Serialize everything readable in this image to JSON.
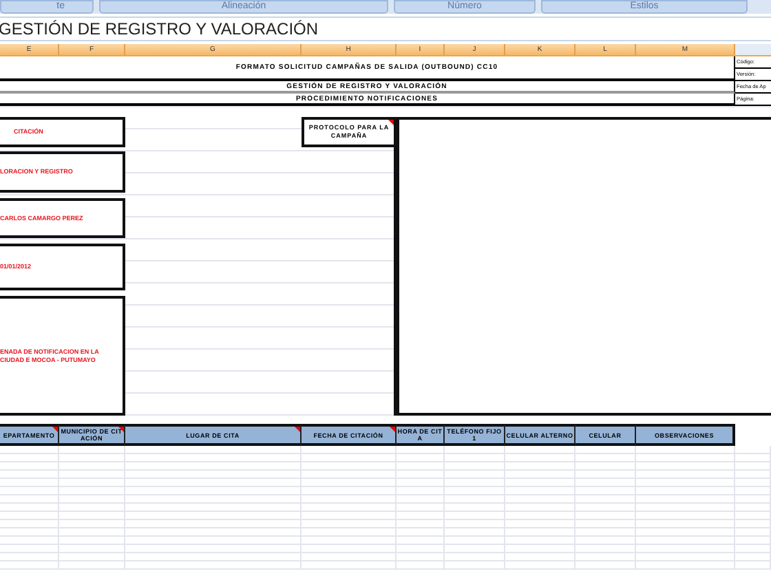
{
  "ribbon": {
    "groups": [
      {
        "label": "te"
      },
      {
        "label": "Alineación"
      },
      {
        "label": "Número"
      },
      {
        "label": "Estilos"
      }
    ]
  },
  "title_bar": {
    "title": "GESTIÓN DE REGISTRO Y VALORACIÓN"
  },
  "column_headers": [
    "E",
    "F",
    "G",
    "H",
    "I",
    "J",
    "K",
    "L",
    "M"
  ],
  "form_header": {
    "title": "FORMATO SOLICITUD CAMPAÑAS DE SALIDA (OUTBOUND) CC10",
    "subtitle": "GESTIÓN DE REGISTRO Y VALORACIÓN",
    "procedure": "PROCEDIMIENTO NOTIFICACIONES",
    "meta_labels": [
      "Código:",
      "Versión:",
      "Fecha de Ap",
      "Página:"
    ]
  },
  "fields": [
    {
      "value": "CITACIÓN"
    },
    {
      "value": "LORACION Y REGISTRO"
    },
    {
      "value": "CARLOS CAMARGO PEREZ"
    },
    {
      "value": "01/01/2012"
    },
    {
      "value": "ENADA DE NOTIFICACION EN LA CIUDAD E MOCOA - PUTUMAYO"
    }
  ],
  "protocol": {
    "label": "PROTOCOLO PARA LA CAMPAÑA",
    "has_comment": true
  },
  "table": {
    "columns": [
      {
        "label": "EPARTAMENTO",
        "has_comment": true
      },
      {
        "label": "MUNICIPIO DE CITACIÓN",
        "has_comment": true
      },
      {
        "label": "LUGAR DE CITA",
        "has_comment": true
      },
      {
        "label": "FECHA DE CITACIÓN",
        "has_comment": true
      },
      {
        "label": "HORA DE CITA",
        "has_comment": false
      },
      {
        "label": "TELÉFONO FIJO 1",
        "has_comment": false
      },
      {
        "label": "CELULAR ALTERNO",
        "has_comment": false
      },
      {
        "label": "CELULAR",
        "has_comment": false
      },
      {
        "label": "OBSERVACIONES",
        "has_comment": false
      }
    ]
  }
}
